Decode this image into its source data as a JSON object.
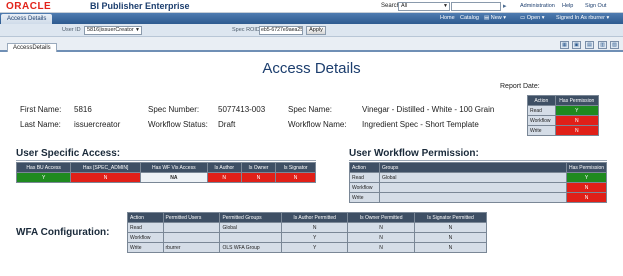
{
  "header": {
    "logo": "ORACLE",
    "app_title": "BI Publisher Enterprise",
    "search_label": "Search",
    "search_scope": "All",
    "links": [
      "Administration",
      "Help",
      "Sign Out"
    ]
  },
  "nav": {
    "active_tab": "Access Details",
    "links": [
      "Home",
      "Catalog",
      "New",
      "Open",
      "Signed In As rburrer"
    ]
  },
  "params": {
    "userid_label": "User ID",
    "userid_value": "5816|issuerCreator",
    "specroid_label": "Spec ROID",
    "specroid_value": "eb5-6727e9aea258",
    "apply_label": "Apply"
  },
  "report_tab": "AccessDetails",
  "report": {
    "title": "Access Details",
    "report_date_label": "Report Date:",
    "first_name_label": "First Name:",
    "first_name": "5816",
    "last_name_label": "Last Name:",
    "last_name": "issuercreator",
    "spec_number_label": "Spec Number:",
    "spec_number": "5077413-003",
    "workflow_status_label": "Workflow Status:",
    "workflow_status": "Draft",
    "spec_name_label": "Spec Name:",
    "spec_name": "Vinegar - Distilled - White - 100 Grain",
    "workflow_name_label": "Workflow Name:",
    "workflow_name": "Ingredient Spec - Short Template"
  },
  "permission_table": {
    "headers": [
      "Action",
      "Has Permission"
    ],
    "rows": [
      {
        "action": "Read",
        "value": "Y",
        "status": "green"
      },
      {
        "action": "Workflow",
        "value": "N",
        "status": "red"
      },
      {
        "action": "Write",
        "value": "N",
        "status": "red"
      }
    ]
  },
  "user_specific": {
    "title": "User Specific Access:",
    "headers": [
      "Has BU Access",
      "Has [SPEC_ADMIN]",
      "Has WF Vis Access",
      "Is Author",
      "Is Owner",
      "Is Signator"
    ],
    "values": [
      {
        "value": "Y",
        "status": "green"
      },
      {
        "value": "N",
        "status": "red"
      },
      {
        "value": "NA",
        "status": "plain"
      },
      {
        "value": "N",
        "status": "red"
      },
      {
        "value": "N",
        "status": "red"
      },
      {
        "value": "N",
        "status": "red"
      }
    ]
  },
  "workflow_permission": {
    "title": "User Workflow Permission:",
    "headers": [
      "Action",
      "Groups",
      "Has Permission"
    ],
    "rows": [
      {
        "action": "Read",
        "groups": "Global",
        "value": "Y",
        "status": "green"
      },
      {
        "action": "Workflow",
        "groups": "",
        "value": "N",
        "status": "red"
      },
      {
        "action": "Write",
        "groups": "",
        "value": "N",
        "status": "red"
      }
    ]
  },
  "wfa": {
    "title": "WFA Configuration:",
    "headers": [
      "Action",
      "Permitted Users",
      "Permitted Groups",
      "Is Author Permitted",
      "Is Owner Permitted",
      "Is Signator Permitted"
    ],
    "rows": [
      {
        "action": "Read",
        "users": "",
        "groups": "Global",
        "author": "N",
        "owner": "N",
        "signator": "N"
      },
      {
        "action": "Workflow",
        "users": "",
        "groups": "",
        "author": "Y",
        "owner": "N",
        "signator": "N"
      },
      {
        "action": "Write",
        "users": "rburrer",
        "groups": "OLS WFA Group",
        "author": "Y",
        "owner": "N",
        "signator": "N"
      }
    ]
  },
  "colors": {
    "green": "#1f8a1f",
    "red": "#e02018",
    "header_blue": "#2d5a8f",
    "table_header": "#3e4f64"
  }
}
